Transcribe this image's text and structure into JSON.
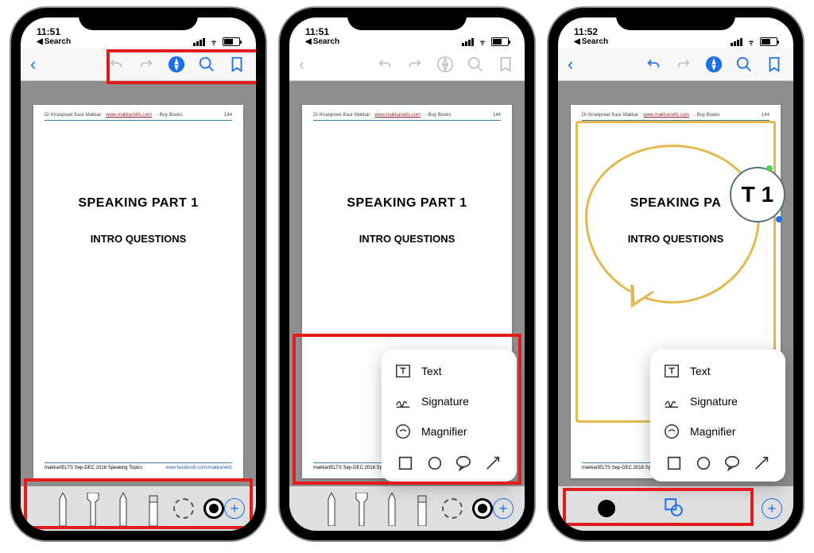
{
  "status": {
    "time1": "11:51",
    "time2": "11:51",
    "time3": "11:52",
    "back": "Search"
  },
  "doc": {
    "author": "Dr Kiranpreet Kaur Makkar",
    "site": "www.makkarielts.com",
    "buy": "- Buy Books",
    "pageno": "144",
    "title": "SPEAKING PART 1",
    "title_annot": "SPEAKING PA",
    "subtitle": "INTRO QUESTIONS",
    "footer_left": "makkarIELTS Sep-DEC 2018 Speaking Topics",
    "footer_right": "www.facebook.com/makkarielts"
  },
  "popup": {
    "text": "Text",
    "sign": "Signature",
    "mag": "Magnifier"
  },
  "mag_text": "T 1"
}
